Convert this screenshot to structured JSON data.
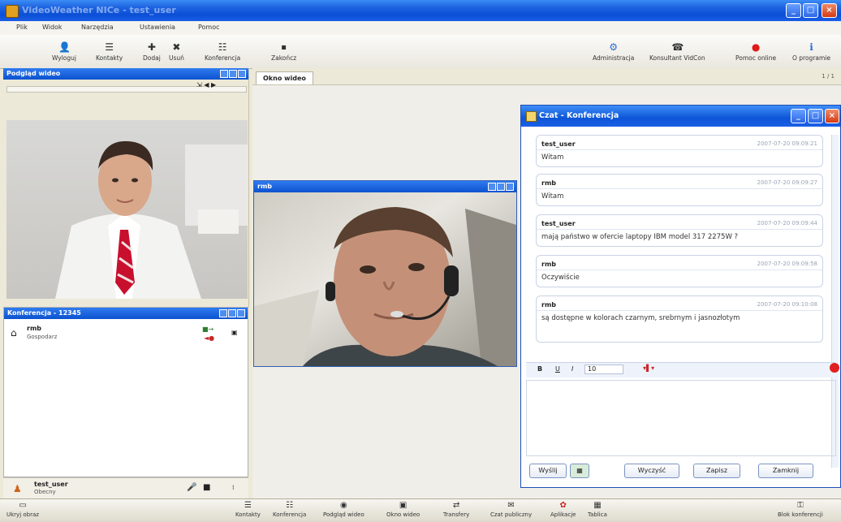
{
  "window": {
    "title": "VideoWeather NICe - test_user"
  },
  "menu": [
    "Plik",
    "Widok",
    "Narzędzia",
    "Ustawienia",
    "Pomoc"
  ],
  "toolbar": {
    "left": [
      {
        "label": "Wyloguj",
        "icon": "user-icon"
      },
      {
        "label": "Kontakty",
        "icon": "contacts-icon"
      },
      {
        "label": "Dodaj",
        "icon": "add-user-icon"
      },
      {
        "label": "Usuń",
        "icon": "remove-user-icon"
      },
      {
        "label": "Konferencja",
        "icon": "conference-icon"
      },
      {
        "label": "Zakończ",
        "icon": "end-icon"
      }
    ],
    "right": [
      {
        "label": "Administracja",
        "icon": "admin-icon"
      },
      {
        "label": "Konsultant VidCon",
        "icon": "consultant-icon"
      },
      {
        "label": "Pomoc online",
        "icon": "help-icon"
      },
      {
        "label": "O programie",
        "icon": "info-icon"
      }
    ]
  },
  "preview_panel": {
    "title": "Podgląd wideo"
  },
  "conference_panel": {
    "title": "Konferencja - 12345",
    "participant": {
      "name": "rmb",
      "status": "Gospodarz"
    }
  },
  "current_user": {
    "name": "test_user",
    "status": "Obecny"
  },
  "tabs": [
    "Okno wideo"
  ],
  "center_pager": "1 / 1",
  "cam_window": {
    "title": "rmb"
  },
  "chat": {
    "title": "Czat - Konferencja",
    "messages": [
      {
        "sender": "test_user",
        "time": "2007-07-20 09:09:21",
        "text": "Witam"
      },
      {
        "sender": "rmb",
        "time": "2007-07-20 09:09:27",
        "text": "Witam"
      },
      {
        "sender": "test_user",
        "time": "2007-07-20 09:09:44",
        "text": "mają państwo w ofercie laptopy IBM model 317 2275W ?"
      },
      {
        "sender": "rmb",
        "time": "2007-07-20 09:09:58",
        "text": "Oczywiście"
      },
      {
        "sender": "rmb",
        "time": "2007-07-20 09:10:08",
        "text": "są dostępne w kolorach czarnym, srebrnym i jasnozłotym"
      }
    ],
    "format": {
      "bold": "B",
      "italic": "I",
      "underline": "U",
      "font_size": "10"
    },
    "buttons": [
      "Wyślij",
      "Wyczyść",
      "Zapisz",
      "Zamknij"
    ]
  },
  "bottom_left": {
    "label": "Ukryj obraz"
  },
  "bottom_bar": [
    {
      "label": "Kontakty",
      "icon": "contacts-icon"
    },
    {
      "label": "Konferencja",
      "icon": "conference-icon"
    },
    {
      "label": "Podgląd wideo",
      "icon": "camera-icon"
    },
    {
      "label": "Okno wideo",
      "icon": "video-window-icon"
    },
    {
      "label": "Transfery",
      "icon": "transfer-icon"
    },
    {
      "label": "Czat publiczny",
      "icon": "chat-icon"
    },
    {
      "label": "Aplikacje",
      "icon": "apps-icon"
    },
    {
      "label": "Tablica",
      "icon": "board-icon"
    }
  ],
  "bottom_right": {
    "label": "Blok konferencji"
  },
  "colors": {
    "titlebar": "#0b4fd6",
    "panel_header": "#1a62dc",
    "chat_border": "#1e4fb8"
  }
}
